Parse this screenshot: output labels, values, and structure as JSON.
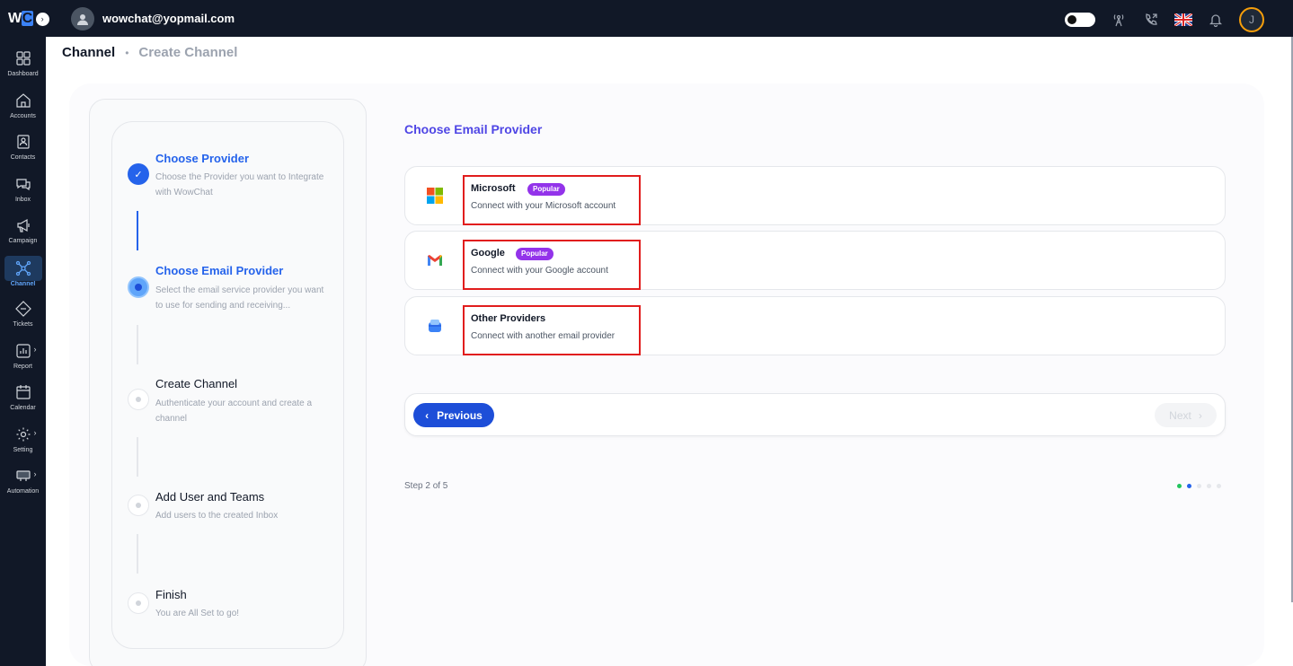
{
  "topbar": {
    "logo": "WC",
    "user_email": "wowchat@yopmail.com",
    "avatar_initial": "J"
  },
  "sidebar": {
    "items": [
      {
        "label": "Dashboard",
        "icon": "dashboard-icon"
      },
      {
        "label": "Accounts",
        "icon": "home-icon"
      },
      {
        "label": "Contacts",
        "icon": "contact-card-icon"
      },
      {
        "label": "Inbox",
        "icon": "chat-bubbles-icon"
      },
      {
        "label": "Campaign",
        "icon": "megaphone-icon"
      },
      {
        "label": "Channel",
        "icon": "channel-network-icon",
        "active": true
      },
      {
        "label": "Tickets",
        "icon": "ticket-icon"
      },
      {
        "label": "Report",
        "icon": "report-chart-icon"
      },
      {
        "label": "Calendar",
        "icon": "calendar-icon"
      },
      {
        "label": "Setting",
        "icon": "gear-icon"
      },
      {
        "label": "Automation",
        "icon": "automation-icon"
      }
    ]
  },
  "breadcrumb": {
    "current": "Channel",
    "sub": "Create Channel"
  },
  "steps": [
    {
      "title": "Choose Provider",
      "desc": "Choose the Provider you want to Integrate with WowChat",
      "state": "done"
    },
    {
      "title": "Choose Email Provider",
      "desc": "Select the email service provider you want to use for sending and receiving...",
      "state": "current"
    },
    {
      "title": "Create Channel",
      "desc": "Authenticate your account and create a channel",
      "state": "todo"
    },
    {
      "title": "Add User and Teams",
      "desc": "Add users to the created Inbox",
      "state": "todo"
    },
    {
      "title": "Finish",
      "desc": "You are All Set to go!",
      "state": "todo"
    }
  ],
  "content": {
    "title": "Choose Email Provider",
    "providers": [
      {
        "name": "Microsoft",
        "badge": "Popular",
        "desc": "Connect with your Microsoft account",
        "icon": "microsoft-logo-icon"
      },
      {
        "name": "Google",
        "badge": "Popular",
        "desc": "Connect with your Google account",
        "icon": "gmail-logo-icon"
      },
      {
        "name": "Other Providers",
        "badge": "",
        "desc": "Connect with another email provider",
        "icon": "mailbox-icon"
      }
    ],
    "previous_label": "Previous",
    "next_label": "Next",
    "step_count": "Step 2 of 5"
  },
  "colors": {
    "accent": "#1d4ed8",
    "highlight_box": "#e11d1d",
    "badge": "#9333ea",
    "dot_done": "#22c55e",
    "dot_current": "#2563eb",
    "dot_todo": "#e5e7eb"
  }
}
